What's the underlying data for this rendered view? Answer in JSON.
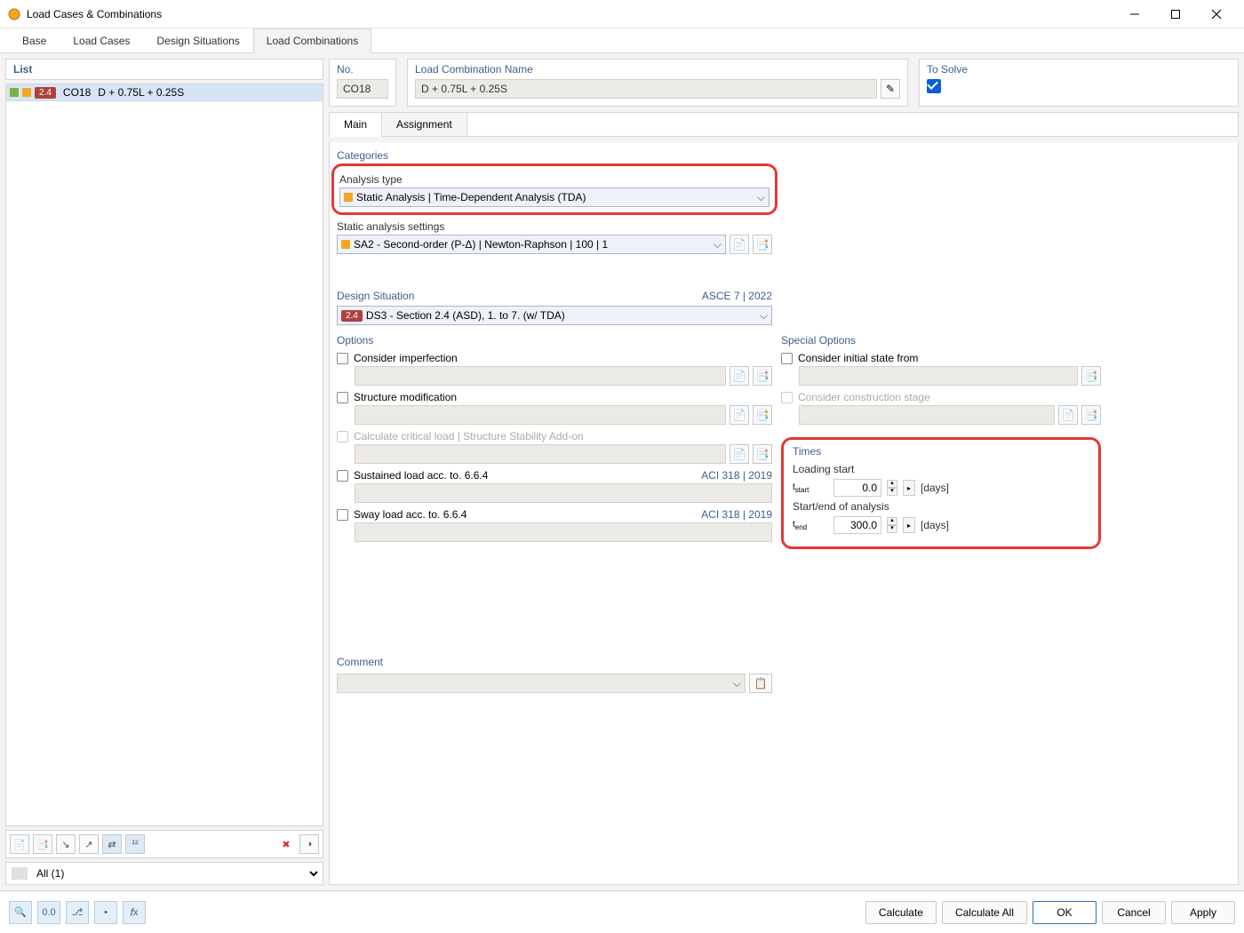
{
  "window": {
    "title": "Load Cases & Combinations"
  },
  "top_tabs": {
    "base": "Base",
    "load_cases": "Load Cases",
    "design_situations": "Design Situations",
    "load_combinations": "Load Combinations"
  },
  "left": {
    "header": "List",
    "item": {
      "badge": "2.4",
      "code": "CO18",
      "desc": "D + 0.75L + 0.25S"
    },
    "filter": "All (1)"
  },
  "header": {
    "no_label": "No.",
    "no_value": "CO18",
    "name_label": "Load Combination Name",
    "name_value": "D + 0.75L + 0.25S",
    "solve_label": "To Solve"
  },
  "subtabs": {
    "main": "Main",
    "assignment": "Assignment"
  },
  "categories": {
    "title": "Categories",
    "analysis_type_label": "Analysis type",
    "analysis_type_value": "Static Analysis | Time-Dependent Analysis (TDA)",
    "sas_label": "Static analysis settings",
    "sas_value": "SA2 - Second-order (P-Δ) | Newton-Raphson | 100 | 1"
  },
  "design_situation": {
    "title": "Design Situation",
    "right": "ASCE 7 | 2022",
    "badge": "2.4",
    "value": "DS3 - Section 2.4 (ASD), 1. to 7. (w/ TDA)"
  },
  "options": {
    "title": "Options",
    "imperfection": "Consider imperfection",
    "structure_mod": "Structure modification",
    "critical_load": "Calculate critical load | Structure Stability Add-on",
    "sustained": "Sustained load acc. to. 6.6.4",
    "sway": "Sway load acc. to. 6.6.4",
    "aci_ref": "ACI 318 | 2019"
  },
  "special": {
    "title": "Special Options",
    "initial_state": "Consider initial state from",
    "construction_stage": "Consider construction stage"
  },
  "times": {
    "title": "Times",
    "loading_start_label": "Loading start",
    "tstart_label": "tstart",
    "tstart_value": "0.0",
    "analysis_label": "Start/end of analysis",
    "tend_label": "tend",
    "tend_value": "300.0",
    "unit": "[days]"
  },
  "comment": {
    "title": "Comment",
    "value": ""
  },
  "footer": {
    "calculate": "Calculate",
    "calculate_all": "Calculate All",
    "ok": "OK",
    "cancel": "Cancel",
    "apply": "Apply"
  }
}
